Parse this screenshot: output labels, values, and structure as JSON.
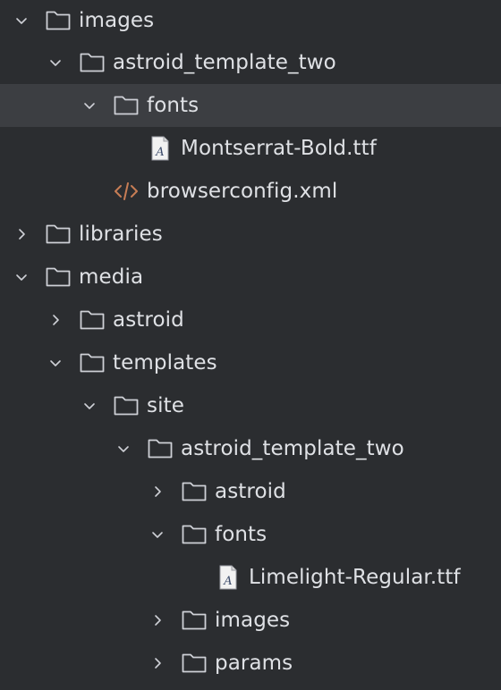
{
  "colors": {
    "background": "#2b2d30",
    "selected_row": "#3c3e42",
    "text": "#dfe1e5",
    "icon_stroke": "#ced0d6",
    "xml_icon": "#c77d55"
  },
  "tree": {
    "items": [
      {
        "label": "images",
        "icon": "folder-icon",
        "expander": "chevron-down-icon",
        "state": "expanded"
      },
      {
        "label": "astroid_template_two",
        "icon": "folder-icon",
        "expander": "chevron-down-icon",
        "state": "expanded"
      },
      {
        "label": "fonts",
        "icon": "folder-icon",
        "expander": "chevron-down-icon",
        "state": "expanded",
        "selected": true
      },
      {
        "label": "Montserrat-Bold.ttf",
        "icon": "font-file-icon"
      },
      {
        "label": "browserconfig.xml",
        "icon": "xml-file-icon"
      },
      {
        "label": "libraries",
        "icon": "folder-icon",
        "expander": "chevron-right-icon",
        "state": "collapsed"
      },
      {
        "label": "media",
        "icon": "folder-icon",
        "expander": "chevron-down-icon",
        "state": "expanded"
      },
      {
        "label": "astroid",
        "icon": "folder-icon",
        "expander": "chevron-right-icon",
        "state": "collapsed"
      },
      {
        "label": "templates",
        "icon": "folder-icon",
        "expander": "chevron-down-icon",
        "state": "expanded"
      },
      {
        "label": "site",
        "icon": "folder-icon",
        "expander": "chevron-down-icon",
        "state": "expanded"
      },
      {
        "label": "astroid_template_two",
        "icon": "folder-icon",
        "expander": "chevron-down-icon",
        "state": "expanded"
      },
      {
        "label": "astroid",
        "icon": "folder-icon",
        "expander": "chevron-right-icon",
        "state": "collapsed"
      },
      {
        "label": "fonts",
        "icon": "folder-icon",
        "expander": "chevron-down-icon",
        "state": "expanded"
      },
      {
        "label": "Limelight-Regular.ttf",
        "icon": "font-file-icon"
      },
      {
        "label": "images",
        "icon": "folder-icon",
        "expander": "chevron-right-icon",
        "state": "collapsed"
      },
      {
        "label": "params",
        "icon": "folder-icon",
        "expander": "chevron-right-icon",
        "state": "collapsed"
      }
    ]
  }
}
